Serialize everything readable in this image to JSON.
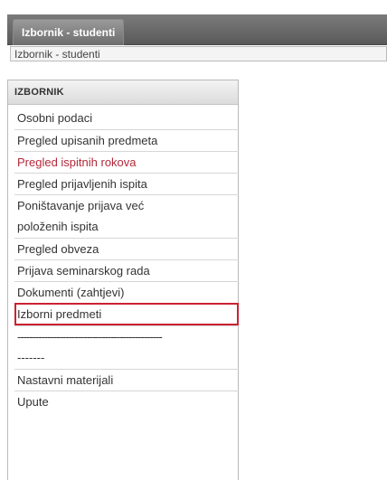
{
  "header": {
    "tab_label": "Izbornik - studenti"
  },
  "breadcrumb": {
    "text": "Izbornik - studenti"
  },
  "menu": {
    "title": "IZBORNIK",
    "items": [
      {
        "label": "Osobni podaci"
      },
      {
        "label": "Pregled upisanih predmeta"
      },
      {
        "label": "Pregled ispitnih rokova",
        "state": "active"
      },
      {
        "label": "Pregled prijavljenih ispita"
      },
      {
        "label": "Poništavanje prijava već"
      },
      {
        "label": "položenih ispita"
      },
      {
        "label": "Pregled obveza"
      },
      {
        "label": "Prijava seminarskog rada"
      },
      {
        "label": "Dokumenti (zahtjevi)"
      },
      {
        "label": "Izborni predmeti",
        "state": "highlighted"
      },
      {
        "label": "------------------------------------------------"
      },
      {
        "label": "-------"
      },
      {
        "label": "Nastavni materijali"
      },
      {
        "label": "Upute"
      }
    ]
  },
  "colors": {
    "active_text": "#b3283a",
    "highlight_border": "#cc2233",
    "header_bar": "#6a6a6a"
  }
}
